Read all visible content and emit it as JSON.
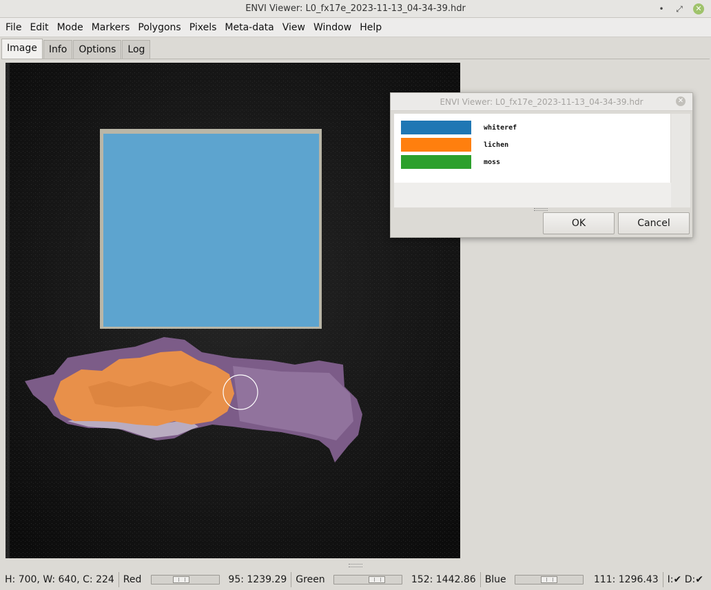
{
  "window": {
    "title": "ENVI Viewer: L0_fx17e_2023-11-13_04-34-39.hdr",
    "minimize_icon": "•",
    "maximize_icon": "⤢",
    "close_icon": "✕"
  },
  "menu": [
    "File",
    "Edit",
    "Mode",
    "Markers",
    "Polygons",
    "Pixels",
    "Meta-data",
    "View",
    "Window",
    "Help"
  ],
  "tabs": [
    {
      "label": "Image",
      "active": true
    },
    {
      "label": "Info",
      "active": false
    },
    {
      "label": "Options",
      "active": false
    },
    {
      "label": "Log",
      "active": false
    }
  ],
  "status": {
    "dims": "H: 700, W: 640, C: 224",
    "red": {
      "label": "Red",
      "value": "95: 1239.29",
      "position": 0.42
    },
    "green": {
      "label": "Green",
      "value": "152: 1442.86",
      "position": 0.68
    },
    "blue": {
      "label": "Blue",
      "value": "111: 1296.43",
      "position": 0.5
    },
    "flags": "I:✔ D:✔"
  },
  "dialog": {
    "title": "ENVI Viewer: L0_fx17e_2023-11-13_04-34-39.hdr",
    "close_icon": "✕",
    "legend": [
      {
        "label": "whiteref",
        "color": "#1f77b4"
      },
      {
        "label": "lichen",
        "color": "#ff7f0e"
      },
      {
        "label": "moss",
        "color": "#2ca02c"
      }
    ],
    "ok_label": "OK",
    "cancel_label": "Cancel"
  },
  "colors": {
    "whiteref_overlay": "#5da4cf",
    "lichen_overlay": "#e8904a",
    "moss_specimen": "#8a6a96"
  }
}
